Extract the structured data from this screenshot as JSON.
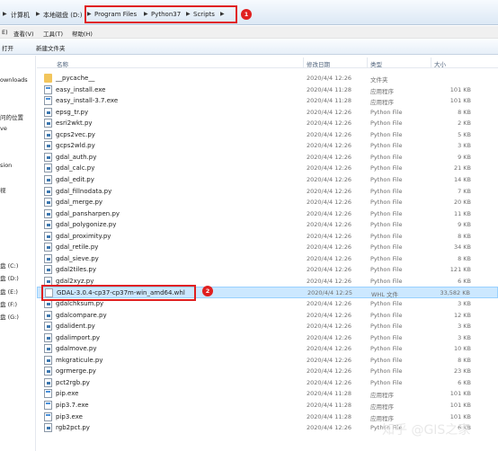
{
  "address": {
    "parts": [
      "计算机",
      "本地磁盘 (D:)",
      "Program Files",
      "Python37",
      "Scripts"
    ],
    "badge1": "1"
  },
  "menu": {
    "items": [
      "E)",
      "查看(V)",
      "工具(T)",
      "帮助(H)"
    ]
  },
  "toolbar": {
    "items": [
      "打开",
      "新建文件夹"
    ]
  },
  "nav": {
    "items": [
      "ownloads",
      "问的位置",
      "ve",
      "sion",
      "视",
      "盘 (C:)",
      "盘 (D:)",
      "盘 (E:)",
      "盘 (F:)",
      "盘 (G:)"
    ]
  },
  "columns": {
    "name": "名称",
    "date": "修改日期",
    "type": "类型",
    "size": "大小"
  },
  "files": [
    {
      "name": "__pycache__",
      "date": "2020/4/4 12:26",
      "type": "文件夹",
      "size": "",
      "icon": "folder-icon"
    },
    {
      "name": "easy_install.exe",
      "date": "2020/4/4 11:28",
      "type": "应用程序",
      "size": "101 KB",
      "icon": "exe-icon"
    },
    {
      "name": "easy_install-3.7.exe",
      "date": "2020/4/4 11:28",
      "type": "应用程序",
      "size": "101 KB",
      "icon": "exe-icon"
    },
    {
      "name": "epsg_tr.py",
      "date": "2020/4/4 12:26",
      "type": "Python File",
      "size": "8 KB",
      "icon": "python-file-icon"
    },
    {
      "name": "esri2wkt.py",
      "date": "2020/4/4 12:26",
      "type": "Python File",
      "size": "2 KB",
      "icon": "python-file-icon"
    },
    {
      "name": "gcps2vec.py",
      "date": "2020/4/4 12:26",
      "type": "Python File",
      "size": "5 KB",
      "icon": "python-file-icon"
    },
    {
      "name": "gcps2wld.py",
      "date": "2020/4/4 12:26",
      "type": "Python File",
      "size": "3 KB",
      "icon": "python-file-icon"
    },
    {
      "name": "gdal_auth.py",
      "date": "2020/4/4 12:26",
      "type": "Python File",
      "size": "9 KB",
      "icon": "python-file-icon"
    },
    {
      "name": "gdal_calc.py",
      "date": "2020/4/4 12:26",
      "type": "Python File",
      "size": "21 KB",
      "icon": "python-file-icon"
    },
    {
      "name": "gdal_edit.py",
      "date": "2020/4/4 12:26",
      "type": "Python File",
      "size": "14 KB",
      "icon": "python-file-icon"
    },
    {
      "name": "gdal_fillnodata.py",
      "date": "2020/4/4 12:26",
      "type": "Python File",
      "size": "7 KB",
      "icon": "python-file-icon"
    },
    {
      "name": "gdal_merge.py",
      "date": "2020/4/4 12:26",
      "type": "Python File",
      "size": "20 KB",
      "icon": "python-file-icon"
    },
    {
      "name": "gdal_pansharpen.py",
      "date": "2020/4/4 12:26",
      "type": "Python File",
      "size": "11 KB",
      "icon": "python-file-icon"
    },
    {
      "name": "gdal_polygonize.py",
      "date": "2020/4/4 12:26",
      "type": "Python File",
      "size": "9 KB",
      "icon": "python-file-icon"
    },
    {
      "name": "gdal_proximity.py",
      "date": "2020/4/4 12:26",
      "type": "Python File",
      "size": "8 KB",
      "icon": "python-file-icon"
    },
    {
      "name": "gdal_retile.py",
      "date": "2020/4/4 12:26",
      "type": "Python File",
      "size": "34 KB",
      "icon": "python-file-icon"
    },
    {
      "name": "gdal_sieve.py",
      "date": "2020/4/4 12:26",
      "type": "Python File",
      "size": "8 KB",
      "icon": "python-file-icon"
    },
    {
      "name": "gdal2tiles.py",
      "date": "2020/4/4 12:26",
      "type": "Python File",
      "size": "121 KB",
      "icon": "python-file-icon"
    },
    {
      "name": "gdal2xyz.py",
      "date": "2020/4/4 12:26",
      "type": "Python File",
      "size": "6 KB",
      "icon": "python-file-icon"
    },
    {
      "name": "GDAL-3.0.4-cp37-cp37m-win_amd64.whl",
      "date": "2020/4/4 12:25",
      "type": "WHL 文件",
      "size": "33,582 KB",
      "icon": "whl-file-icon",
      "selected": true
    },
    {
      "name": "gdalchksum.py",
      "date": "2020/4/4 12:26",
      "type": "Python File",
      "size": "3 KB",
      "icon": "python-file-icon"
    },
    {
      "name": "gdalcompare.py",
      "date": "2020/4/4 12:26",
      "type": "Python File",
      "size": "12 KB",
      "icon": "python-file-icon"
    },
    {
      "name": "gdalident.py",
      "date": "2020/4/4 12:26",
      "type": "Python File",
      "size": "3 KB",
      "icon": "python-file-icon"
    },
    {
      "name": "gdalimport.py",
      "date": "2020/4/4 12:26",
      "type": "Python File",
      "size": "3 KB",
      "icon": "python-file-icon"
    },
    {
      "name": "gdalmove.py",
      "date": "2020/4/4 12:26",
      "type": "Python File",
      "size": "10 KB",
      "icon": "python-file-icon"
    },
    {
      "name": "mkgraticule.py",
      "date": "2020/4/4 12:26",
      "type": "Python File",
      "size": "8 KB",
      "icon": "python-file-icon"
    },
    {
      "name": "ogrmerge.py",
      "date": "2020/4/4 12:26",
      "type": "Python File",
      "size": "23 KB",
      "icon": "python-file-icon"
    },
    {
      "name": "pct2rgb.py",
      "date": "2020/4/4 12:26",
      "type": "Python File",
      "size": "6 KB",
      "icon": "python-file-icon"
    },
    {
      "name": "pip.exe",
      "date": "2020/4/4 11:28",
      "type": "应用程序",
      "size": "101 KB",
      "icon": "exe-icon"
    },
    {
      "name": "pip3.7.exe",
      "date": "2020/4/4 11:28",
      "type": "应用程序",
      "size": "101 KB",
      "icon": "exe-icon"
    },
    {
      "name": "pip3.exe",
      "date": "2020/4/4 11:28",
      "type": "应用程序",
      "size": "101 KB",
      "icon": "exe-icon"
    },
    {
      "name": "rgb2pct.py",
      "date": "2020/4/4 12:26",
      "type": "Python File",
      "size": "6 KB",
      "icon": "python-file-icon"
    }
  ],
  "badge2": "2",
  "watermark": "知乎 @GIS之家"
}
